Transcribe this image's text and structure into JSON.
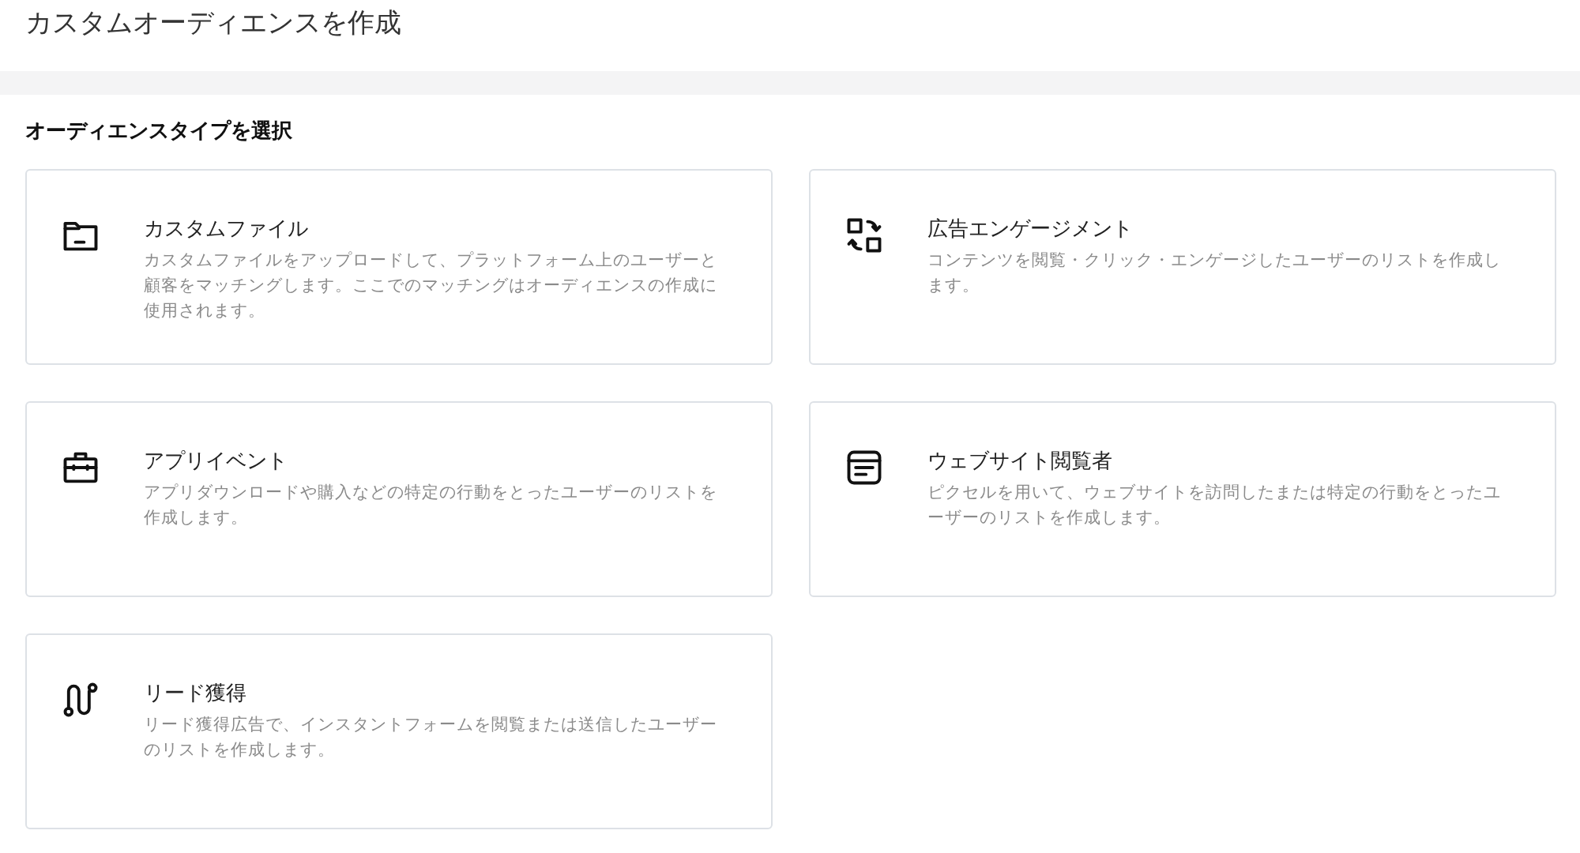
{
  "page": {
    "title": "カスタムオーディエンスを作成"
  },
  "section": {
    "heading": "オーディエンスタイプを選択"
  },
  "cards": [
    {
      "kind": "folder",
      "title": "カスタムファイル",
      "description": "カスタムファイルをアップロードして、プラットフォーム上のユーザーと顧客をマッチングします。ここでのマッチングはオーディエンスの作成に使用されます。"
    },
    {
      "kind": "engagement",
      "title": "広告エンゲージメント",
      "description": "コンテンツを閲覧・クリック・エンゲージしたユーザーのリストを作成します。"
    },
    {
      "kind": "app",
      "title": "アプリイベント",
      "description": "アプリダウンロードや購入などの特定の行動をとったユーザーのリストを作成します。"
    },
    {
      "kind": "website",
      "title": "ウェブサイト閲覧者",
      "description": "ピクセルを用いて、ウェブサイトを訪問したまたは特定の行動をとったユーザーのリストを作成します。"
    },
    {
      "kind": "lead",
      "title": "リード獲得",
      "description": "リード獲得広告で、インスタントフォームを閲覧または送信したユーザーのリストを作成します。"
    }
  ]
}
